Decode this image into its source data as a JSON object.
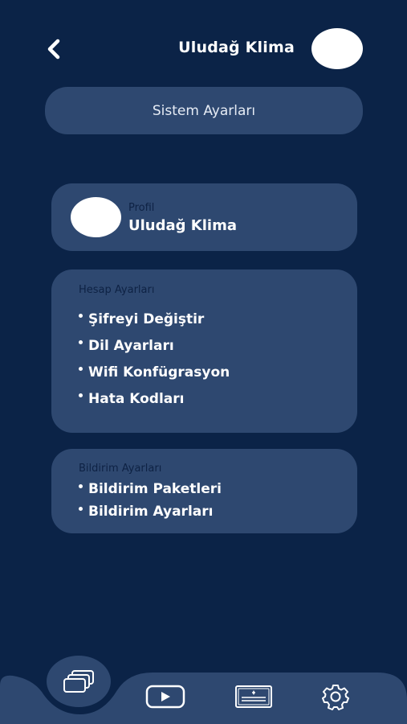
{
  "header": {
    "title": "Uludağ Klima",
    "back_icon": "chevron-left-icon",
    "avatar_color": "#ffffff"
  },
  "system_settings": {
    "label": "Sistem Ayarları"
  },
  "profile": {
    "label": "Profil",
    "name": "Uludağ Klima"
  },
  "account_settings": {
    "title": "Hesap Ayarları",
    "items": [
      {
        "label": "Şifreyi Değiştir"
      },
      {
        "label": "Dil Ayarları"
      },
      {
        "label": "Wifi Konfügrasyon"
      },
      {
        "label": "Hata Kodları"
      }
    ]
  },
  "notification_settings": {
    "title": "Bildirim Ayarları",
    "items": [
      {
        "label": "Bildirim Paketleri"
      },
      {
        "label": "Bildirim Ayarları"
      }
    ]
  },
  "bottom_nav": {
    "items": [
      {
        "icon": "cards-icon",
        "active": true
      },
      {
        "icon": "play-icon",
        "active": false
      },
      {
        "icon": "certificate-icon",
        "active": false
      },
      {
        "icon": "gear-icon",
        "active": false
      }
    ]
  },
  "colors": {
    "background": "#0b2347",
    "card": "#2e4870",
    "section_title": "#0e2244",
    "text": "#ffffff"
  }
}
